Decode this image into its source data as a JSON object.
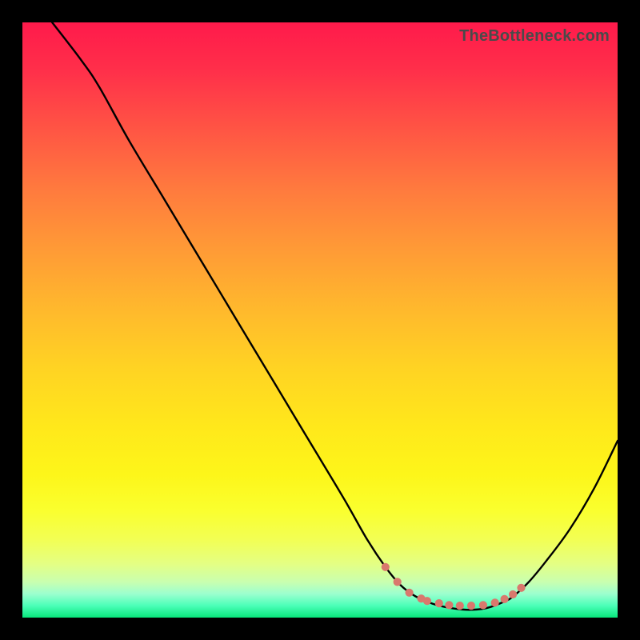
{
  "watermark": "TheBottleneck.com",
  "colors": {
    "background": "#000000",
    "gradient_top": "#ff1a4b",
    "gradient_bottom": "#08e67b",
    "curve": "#000000",
    "dots": "#d9786d"
  },
  "chart_data": {
    "type": "line",
    "title": "",
    "xlabel": "",
    "ylabel": "",
    "xlim": [
      0,
      100
    ],
    "ylim": [
      0,
      100
    ],
    "grid": false,
    "legend": false,
    "note": "No axis ticks or labels visible. Values are estimated from pixel positions relative to the plotting area (0 = bottom/left, 100 = top/right).",
    "series": [
      {
        "name": "curve",
        "x": [
          5,
          10,
          13,
          18,
          24,
          30,
          36,
          42,
          48,
          54,
          58,
          61,
          63.5,
          66,
          69,
          72,
          75,
          78,
          81,
          82.5,
          85,
          88,
          92,
          96,
          100
        ],
        "y": [
          100,
          93.5,
          89,
          80,
          70,
          60,
          50,
          40,
          30,
          20,
          13,
          8.5,
          5.5,
          3.6,
          2.3,
          1.6,
          1.3,
          1.6,
          2.7,
          3.6,
          5.9,
          9.5,
          14.9,
          21.6,
          29.7
        ]
      }
    ],
    "dots": {
      "name": "dotted-band",
      "x": [
        61,
        63,
        65,
        67,
        68,
        70,
        71.7,
        73.5,
        75.4,
        77.4,
        79.4,
        81,
        82.4,
        83.8
      ],
      "y": [
        8.5,
        6.0,
        4.2,
        3.2,
        2.8,
        2.4,
        2.1,
        2.0,
        2.0,
        2.1,
        2.5,
        3.1,
        3.9,
        5.0
      ]
    }
  }
}
